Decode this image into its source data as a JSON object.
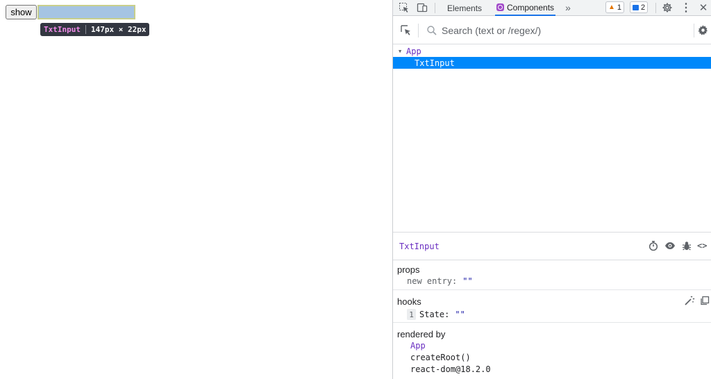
{
  "page": {
    "show_button": "show",
    "input_value": "",
    "tooltip": {
      "component": "TxtInput",
      "size": "147px × 22px"
    }
  },
  "devtools": {
    "toolbar": {
      "tabs": [
        {
          "label": "Elements",
          "active": false
        },
        {
          "label": "Components",
          "active": true
        }
      ],
      "more_tabs_icon": "chevron-double-right-icon",
      "warnings_count": "1",
      "messages_count": "2"
    },
    "search": {
      "placeholder": "Search (text or /regex/)",
      "value": ""
    },
    "tree": [
      {
        "name": "App",
        "expanded": true,
        "selected": false
      },
      {
        "name": "TxtInput",
        "expanded": false,
        "selected": true
      }
    ],
    "inspected": {
      "name": "TxtInput",
      "props": {
        "title": "props",
        "items": [
          {
            "key": "new entry",
            "value": "\"\""
          }
        ]
      },
      "hooks": {
        "title": "hooks",
        "items": [
          {
            "index": "1",
            "key": "State",
            "value": "\"\""
          }
        ]
      },
      "rendered_by": {
        "title": "rendered by",
        "items": [
          "App",
          "createRoot()",
          "react-dom@18.2.0"
        ]
      }
    },
    "colors": {
      "selection": "#0088fa",
      "component": "#6a2fc1",
      "value": "#1a1aa6",
      "accent": "#1a73e8"
    }
  }
}
